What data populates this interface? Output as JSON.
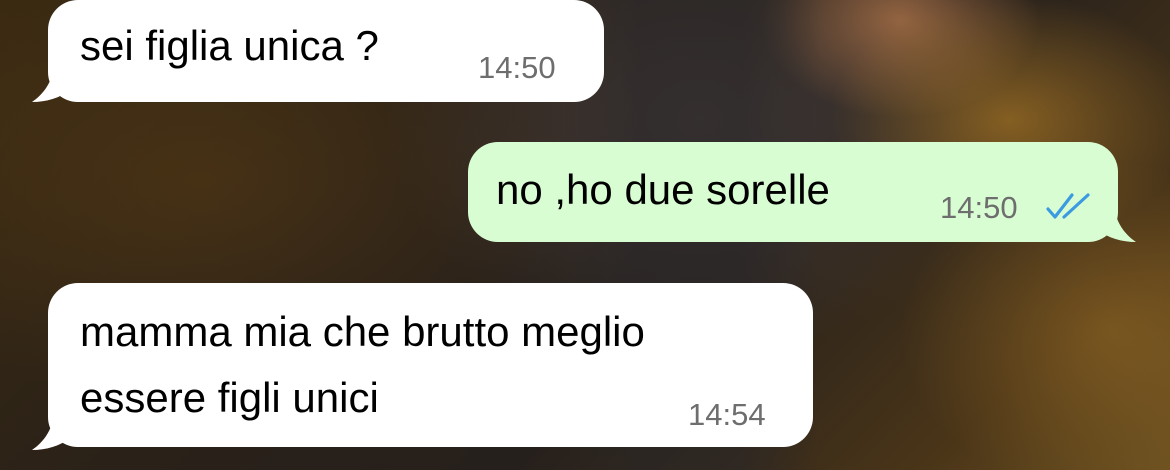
{
  "chat": {
    "messages": [
      {
        "direction": "incoming",
        "text": "sei figlia unica ?",
        "time": "14:50"
      },
      {
        "direction": "outgoing",
        "text": "no ,ho due sorelle",
        "time": "14:50",
        "status": "read",
        "status_icon": "double-check-icon"
      },
      {
        "direction": "incoming",
        "text": "mamma mia che brutto meglio\nessere figli unici",
        "time": "14:54"
      }
    ]
  },
  "colors": {
    "incoming_bubble": "#ffffff",
    "outgoing_bubble": "#d9fdd3",
    "timestamp": "#6e6e6e",
    "read_ticks": "#3a9be0"
  }
}
